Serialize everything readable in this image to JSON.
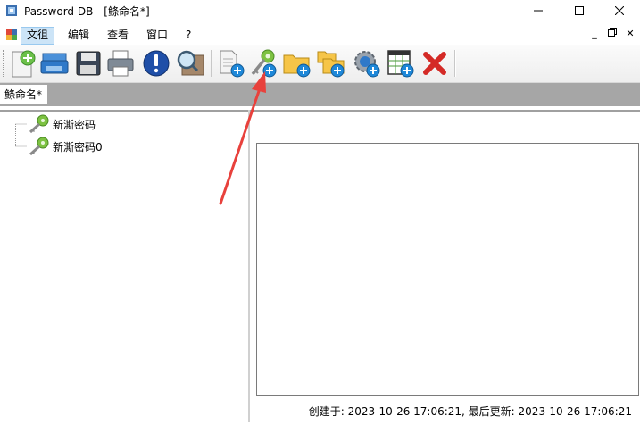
{
  "window": {
    "title": "Password DB - [鲦命名*]",
    "minimize": "—",
    "maximize": "☐",
    "close": "✕"
  },
  "menu": {
    "items": [
      {
        "label": "文徂",
        "active": true
      },
      {
        "label": "编辑"
      },
      {
        "label": "查看"
      },
      {
        "label": "窗口"
      },
      {
        "label": "?"
      }
    ],
    "mdi_min": "_",
    "mdi_restore": "🗗",
    "mdi_close": "✕"
  },
  "toolbar": {
    "buttons": [
      "new-database-icon",
      "open-database-icon",
      "save-icon",
      "print-icon",
      "info-icon",
      "search-icon",
      "add-entry-page-icon",
      "add-password-key-icon",
      "add-folder-icon",
      "add-subfolder-icon",
      "add-settings-icon",
      "add-table-icon",
      "delete-icon"
    ]
  },
  "tab": {
    "label": "鲦命名*"
  },
  "tree": {
    "items": [
      {
        "label": "新澌密码"
      },
      {
        "label": "新澌密码0"
      }
    ]
  },
  "status": {
    "text": "创建于: 2023-10-26 17:06:21, 最后更新: 2023-10-26 17:06:21"
  },
  "colors": {
    "accent_green": "#7dc242",
    "blue_plus": "#1e88d9",
    "annotation_red": "#e8413c"
  }
}
